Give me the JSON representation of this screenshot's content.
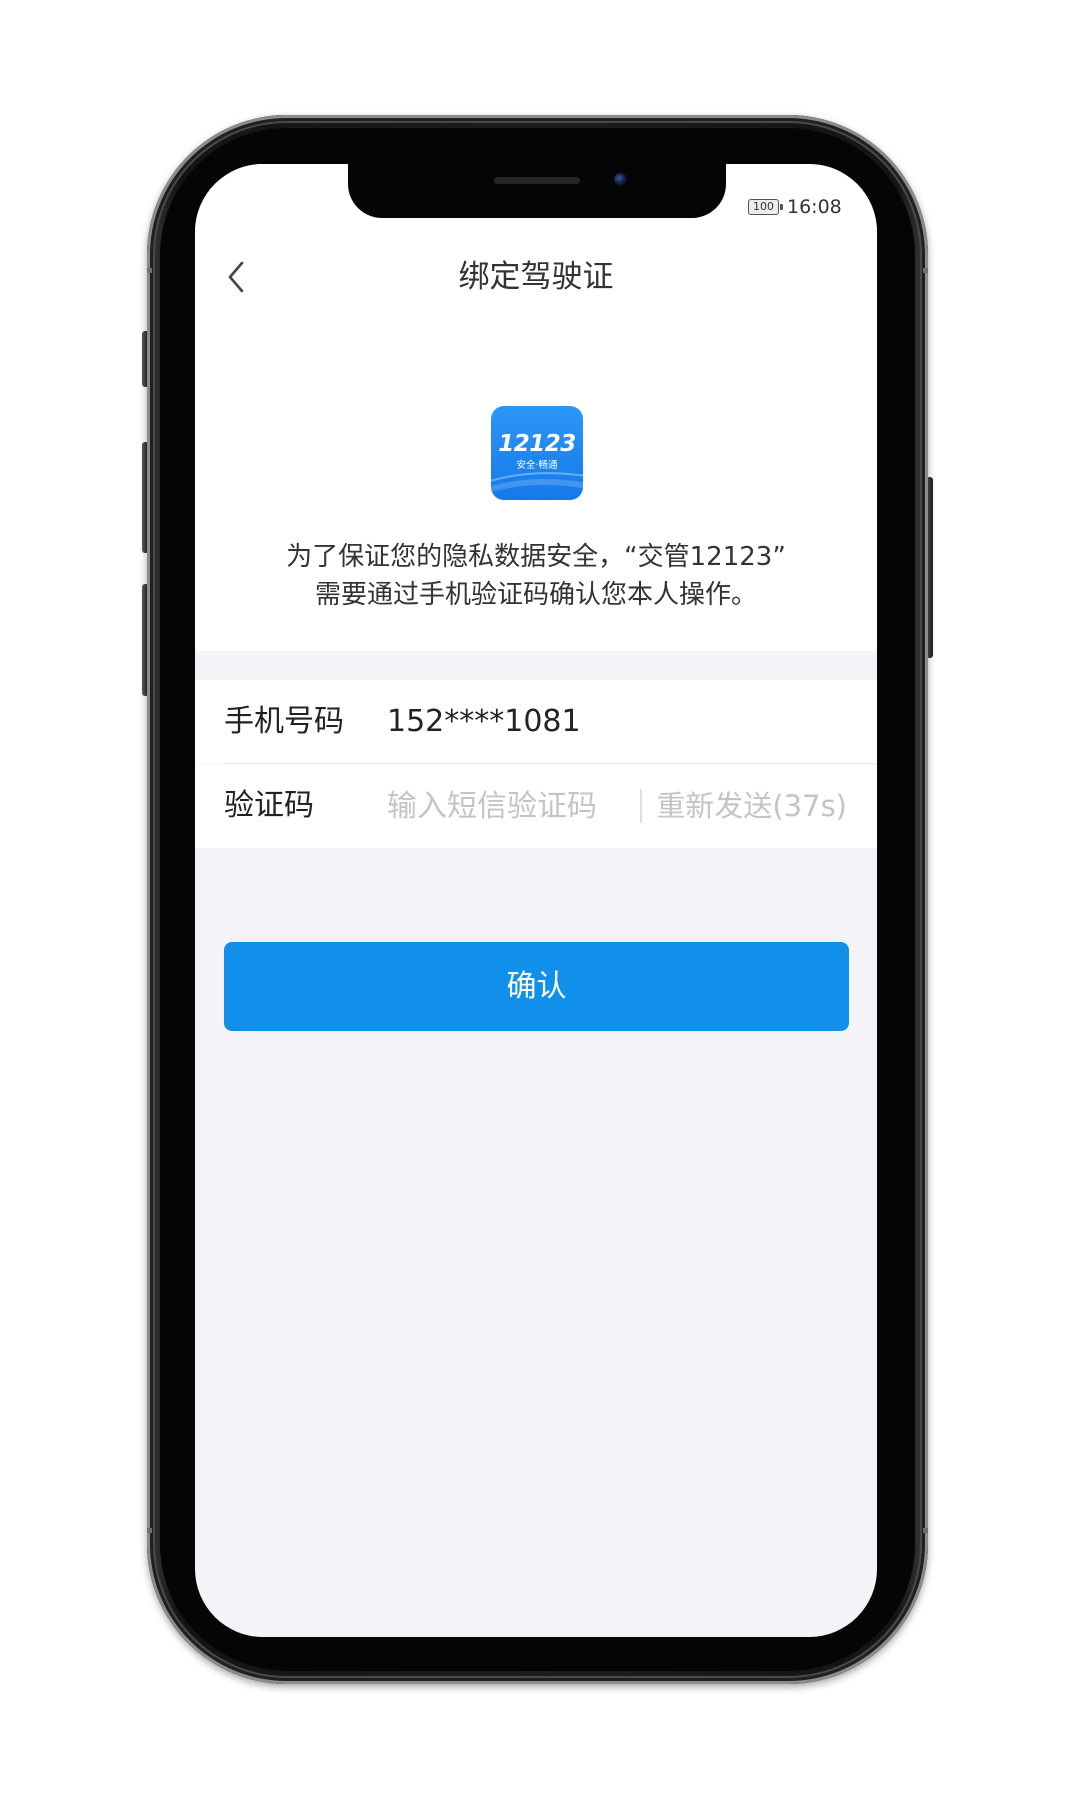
{
  "status_bar": {
    "battery": "100",
    "time": "16:08"
  },
  "nav": {
    "title": "绑定驾驶证"
  },
  "app_icon": {
    "main_text": "12123",
    "sub_text": "安全·畅通"
  },
  "description": {
    "line1": "为了保证您的隐私数据安全，“交管12123”",
    "line2": "需要通过手机验证码确认您本人操作。"
  },
  "form": {
    "phone": {
      "label": "手机号码",
      "value": "152****1081"
    },
    "code": {
      "label": "验证码",
      "placeholder": "输入短信验证码",
      "resend_label": "重新发送(37s)"
    }
  },
  "confirm_button": {
    "label": "确认"
  },
  "icons": {
    "back": "chevron-left-icon",
    "battery": "battery-icon",
    "camera": "front-camera-icon"
  },
  "colors": {
    "primary": "#1190eb",
    "screen_background": "#f4f4f8",
    "text": "#333333",
    "placeholder": "#c4c4c4",
    "icon_blue": "#1579e8"
  }
}
